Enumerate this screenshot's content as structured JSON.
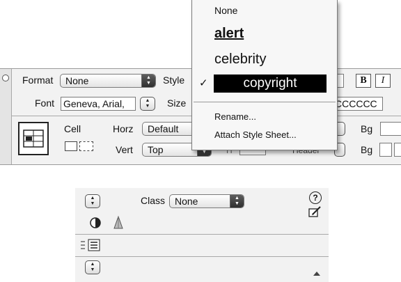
{
  "top_panel": {
    "format_label": "Format",
    "format_value": "None",
    "style_label": "Style",
    "font_label": "Font",
    "font_value": "Geneva, Arial,",
    "size_label": "Size",
    "color_value": "CCCCCC",
    "bold_label": "B",
    "italic_label": "I",
    "cell_label": "Cell",
    "horz_label": "Horz",
    "horz_value": "Default",
    "vert_label": "Vert",
    "vert_value": "Top",
    "h_label": "H",
    "header_label": "Header",
    "bg_label_1": "Bg",
    "bg_label_2": "Bg"
  },
  "style_menu": {
    "items": [
      "None",
      "alert",
      "celebrity",
      "copyright",
      "Rename...",
      "Attach Style Sheet..."
    ],
    "selected": "copyright",
    "checkmark": "✓"
  },
  "bottom_panel": {
    "class_label": "Class",
    "class_value": "None",
    "help_glyph": "?"
  },
  "icons": [
    "table-icon",
    "merge-cells-icon",
    "split-cells-icon",
    "contrast-icon",
    "cone-icon",
    "help-icon",
    "edit-icon",
    "expand-arrow-icon"
  ]
}
